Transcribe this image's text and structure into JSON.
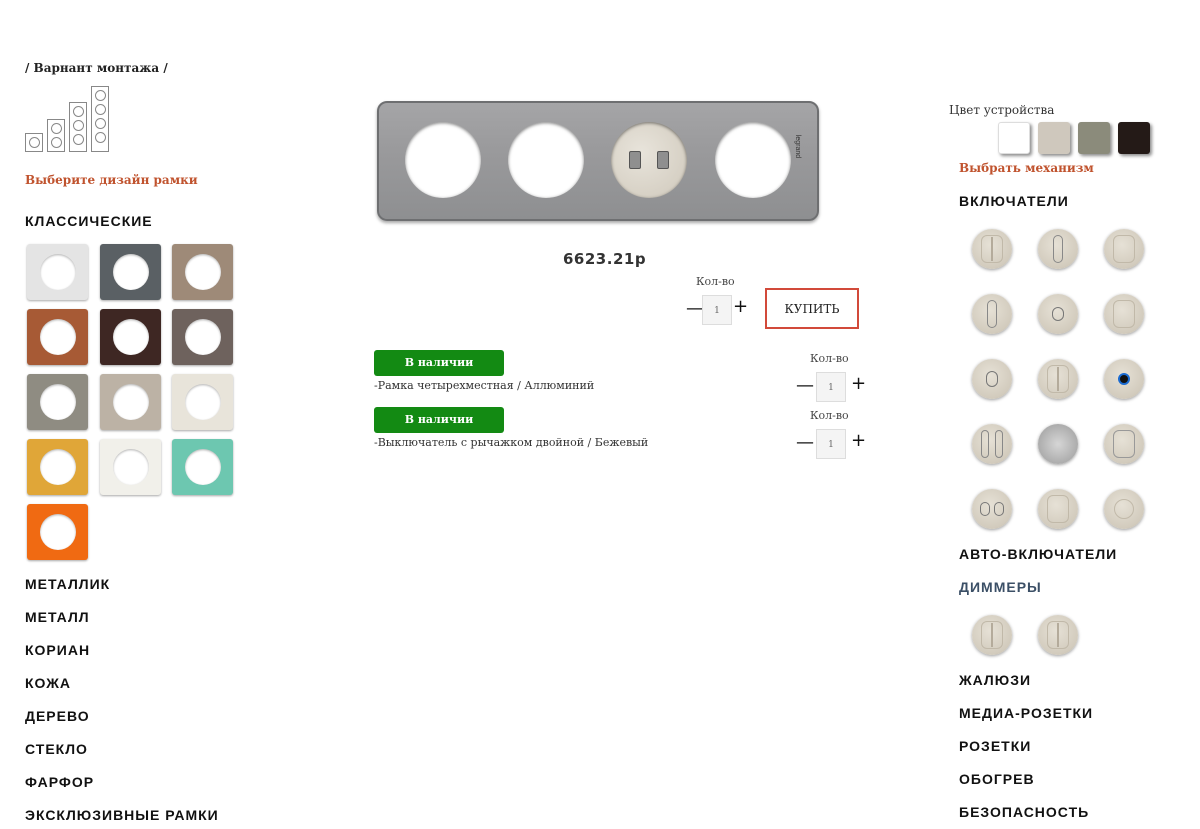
{
  "left": {
    "mount_title": "/ Варнант монтажа /",
    "design_prompt": "Выберите дизайн рамки",
    "categories": [
      "КЛАССИЧЕСКИЕ",
      "МЕТАЛЛИК",
      "МЕТАЛЛ",
      "КОРИАН",
      "КОЖА",
      "ДЕРЕВО",
      "СТЕКЛО",
      "ФАРФОР",
      "ЭКСКЛЮЗИВНЫЕ РАМКИ"
    ],
    "swatch_colors": [
      "#e4e4e4",
      "#5a6064",
      "#9e8a78",
      "#a75a35",
      "#3e2723",
      "#6e625d",
      "#8f8c82",
      "#bcb2a5",
      "#e8e4da",
      "#e0a638",
      "#f1f0ea",
      "#6dc7b0",
      "#f06a12"
    ]
  },
  "product": {
    "price": "6623.21р",
    "qty_label": "Кол-во",
    "qty_value": "1",
    "buy_label": "КУПИТЬ",
    "brand": "legrand"
  },
  "items": [
    {
      "status": "В наличии",
      "description": "-Рамка четырехместная / Аллюминий",
      "qty_label": "Кол-во",
      "qty_value": "1"
    },
    {
      "status": "В наличии",
      "description": "-Выключатель с рычажком двойной / Бежевый",
      "qty_label": "Кол-во",
      "qty_value": "1"
    }
  ],
  "right": {
    "device_color_label": "Цвет устройства",
    "device_colors": [
      "#ffffff",
      "#cfc8bd",
      "#8b8b7b",
      "#241a17"
    ],
    "choose_mechanism": "Выбрать механизм",
    "categories": [
      "ВКЛЮЧАТЕЛИ",
      "АВТО-ВКЛЮЧАТЕЛИ",
      "ДИММЕРЫ",
      "ЖАЛЮЗИ",
      "МЕДИА-РОЗЕТКИ",
      "РОЗЕТКИ",
      "ОБОГРЕВ",
      "БЕЗОПАСНОСТЬ"
    ]
  },
  "icons": {
    "minus": "—",
    "plus": "+"
  }
}
